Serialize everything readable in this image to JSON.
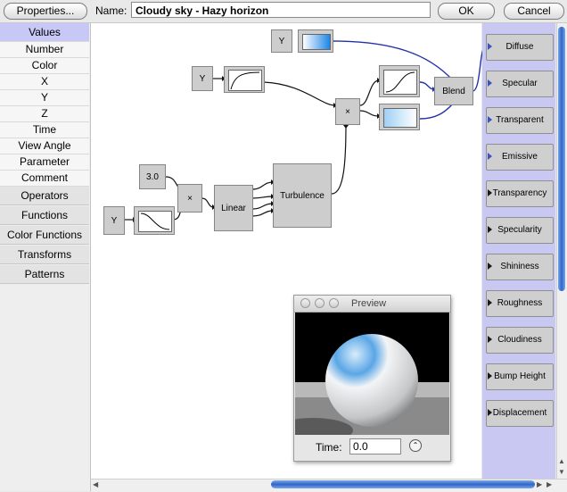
{
  "toolbar": {
    "properties_label": "Properties...",
    "name_label": "Name:",
    "name_value": "Cloudy sky - Hazy horizon",
    "ok_label": "OK",
    "cancel_label": "Cancel"
  },
  "sidebar": {
    "values_label": "Values",
    "value_items": [
      "Number",
      "Color",
      "X",
      "Y",
      "Z",
      "Time",
      "View Angle",
      "Parameter",
      "Comment"
    ],
    "groups": [
      "Operators",
      "Functions",
      "Color Functions",
      "Transforms",
      "Patterns"
    ]
  },
  "nodes": {
    "y_input_label": "Y",
    "number_value": "3.0",
    "multiply_symbol": "×",
    "linear_label": "Linear",
    "turbulence_label": "Turbulence",
    "blend_label": "Blend"
  },
  "outputs": [
    "Diffuse",
    "Specular",
    "Transparent",
    "Emissive",
    "Transparency",
    "Specularity",
    "Shininess",
    "Roughness",
    "Cloudiness",
    "Bump Height",
    "Displacement"
  ],
  "preview": {
    "title": "Preview",
    "time_label": "Time:",
    "time_value": "0.0"
  },
  "colors": {
    "selected_bg": "#c7c8f6",
    "output_panel_bg": "#c8c8f2",
    "scroll_thumb": "#2e66c8",
    "link_blue": "#2333a8"
  }
}
